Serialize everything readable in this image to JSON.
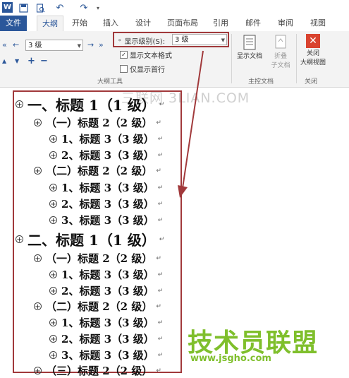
{
  "quick_access": {
    "undo": "↶",
    "redo": "↷"
  },
  "tabs": [
    "文件",
    "大纲",
    "开始",
    "插入",
    "设计",
    "页面布局",
    "引用",
    "邮件",
    "审阅",
    "视图"
  ],
  "ribbon": {
    "level_select_value": "3 级",
    "show_level_label": "显示级别(S):",
    "show_level_value": "3 级",
    "show_text_format": "显示文本格式",
    "show_first_line": "仅显示首行",
    "outline_tools_group": "大纲工具",
    "show_document": "显示文档",
    "collapse_subdoc_line1": "折叠",
    "collapse_subdoc_line2": "子文档",
    "master_doc_group": "主控文档",
    "close_outline_line1": "关闭",
    "close_outline_line2": "大纲视图",
    "close_group": "关闭"
  },
  "outline": [
    {
      "text": "一、标题 1（1 级）",
      "level": 1
    },
    {
      "text": "（一）标题 2（2 级）",
      "level": 2
    },
    {
      "text": "1、标题 3（3 级）",
      "level": 3
    },
    {
      "text": "2、标题 3（3 级）",
      "level": 3
    },
    {
      "text": "（二）标题 2（2 级）",
      "level": 2
    },
    {
      "text": "1、标题 3（3 级）",
      "level": 3
    },
    {
      "text": "2、标题 3（3 级）",
      "level": 3
    },
    {
      "text": "3、标题 3（3 级）",
      "level": 3
    },
    {
      "text": "二、标题 1（1 级）",
      "level": 1
    },
    {
      "text": "（一）标题 2（2 级）",
      "level": 2
    },
    {
      "text": "1、标题 3（3 级）",
      "level": 3
    },
    {
      "text": "2、标题 3（3 级）",
      "level": 3
    },
    {
      "text": "（二）标题 2（2 级）",
      "level": 2
    },
    {
      "text": "1、标题 3（3 级）",
      "level": 3
    },
    {
      "text": "2、标题 3（3 级）",
      "level": 3
    },
    {
      "text": "3、标题 3（3 级）",
      "level": 3
    },
    {
      "text": "（三）标题 2（2 级）",
      "level": 2
    }
  ],
  "watermark": "三联网 3LIAN.COM",
  "brand_text": "技术员联盟",
  "brand_site": "www.jsgho.com",
  "colors": {
    "accent": "#2b579a",
    "highlight": "#a1393b",
    "brand": "#7fbf2c"
  }
}
